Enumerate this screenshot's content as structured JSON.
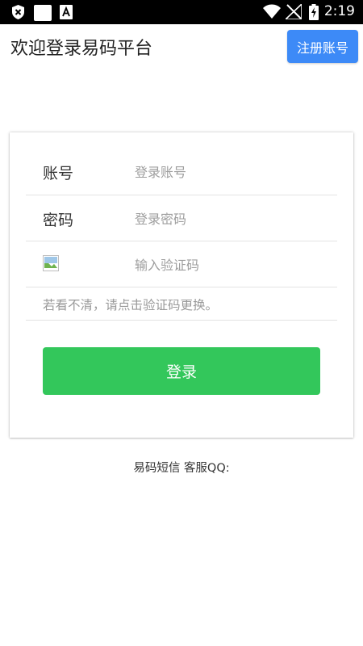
{
  "status_bar": {
    "time": "2:19",
    "icons": [
      "shield-x-icon",
      "blank-square-icon",
      "font-a-icon",
      "wifi-icon",
      "signal-off-icon",
      "battery-charging-icon"
    ]
  },
  "header": {
    "title": "欢迎登录易码平台",
    "register_label": "注册账号"
  },
  "form": {
    "account_label": "账号",
    "account_placeholder": "登录账号",
    "password_label": "密码",
    "password_placeholder": "登录密码",
    "captcha_placeholder": "输入验证码",
    "hint": "若看不清，请点击验证码更换。",
    "login_label": "登录"
  },
  "footer": {
    "text": "易码短信 客服QQ:"
  },
  "colors": {
    "register_button": "#3d8af7",
    "login_button": "#33c75b",
    "status_bar": "#000000"
  }
}
